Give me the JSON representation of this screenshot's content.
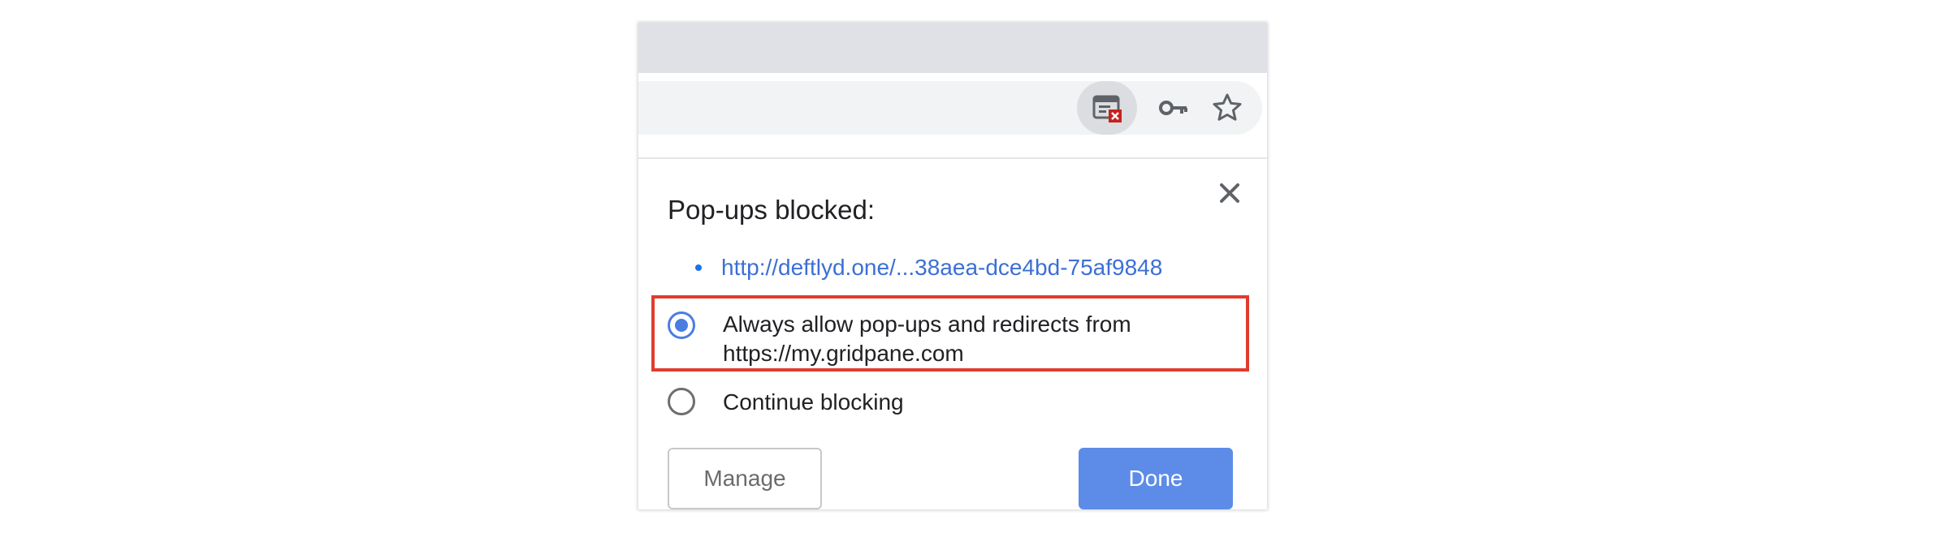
{
  "bubble": {
    "title": "Pop-ups blocked:",
    "blocked_urls": [
      "http://deftlyd.one/...38aea-dce4bd-75af9848"
    ],
    "options": [
      {
        "label": "Always allow pop-ups and redirects from https://my.gridpane.com",
        "selected": true
      },
      {
        "label": "Continue blocking",
        "selected": false
      }
    ],
    "manage_label": "Manage",
    "done_label": "Done"
  },
  "toolbar": {
    "icons": [
      "popup-blocked-icon",
      "key-icon",
      "star-icon"
    ]
  },
  "colors": {
    "link": "#3c6fd6",
    "accent": "#4a7de2",
    "done_button": "#5d8ce8",
    "highlight": "#e03c2e",
    "blocked_badge": "#c5221f"
  }
}
